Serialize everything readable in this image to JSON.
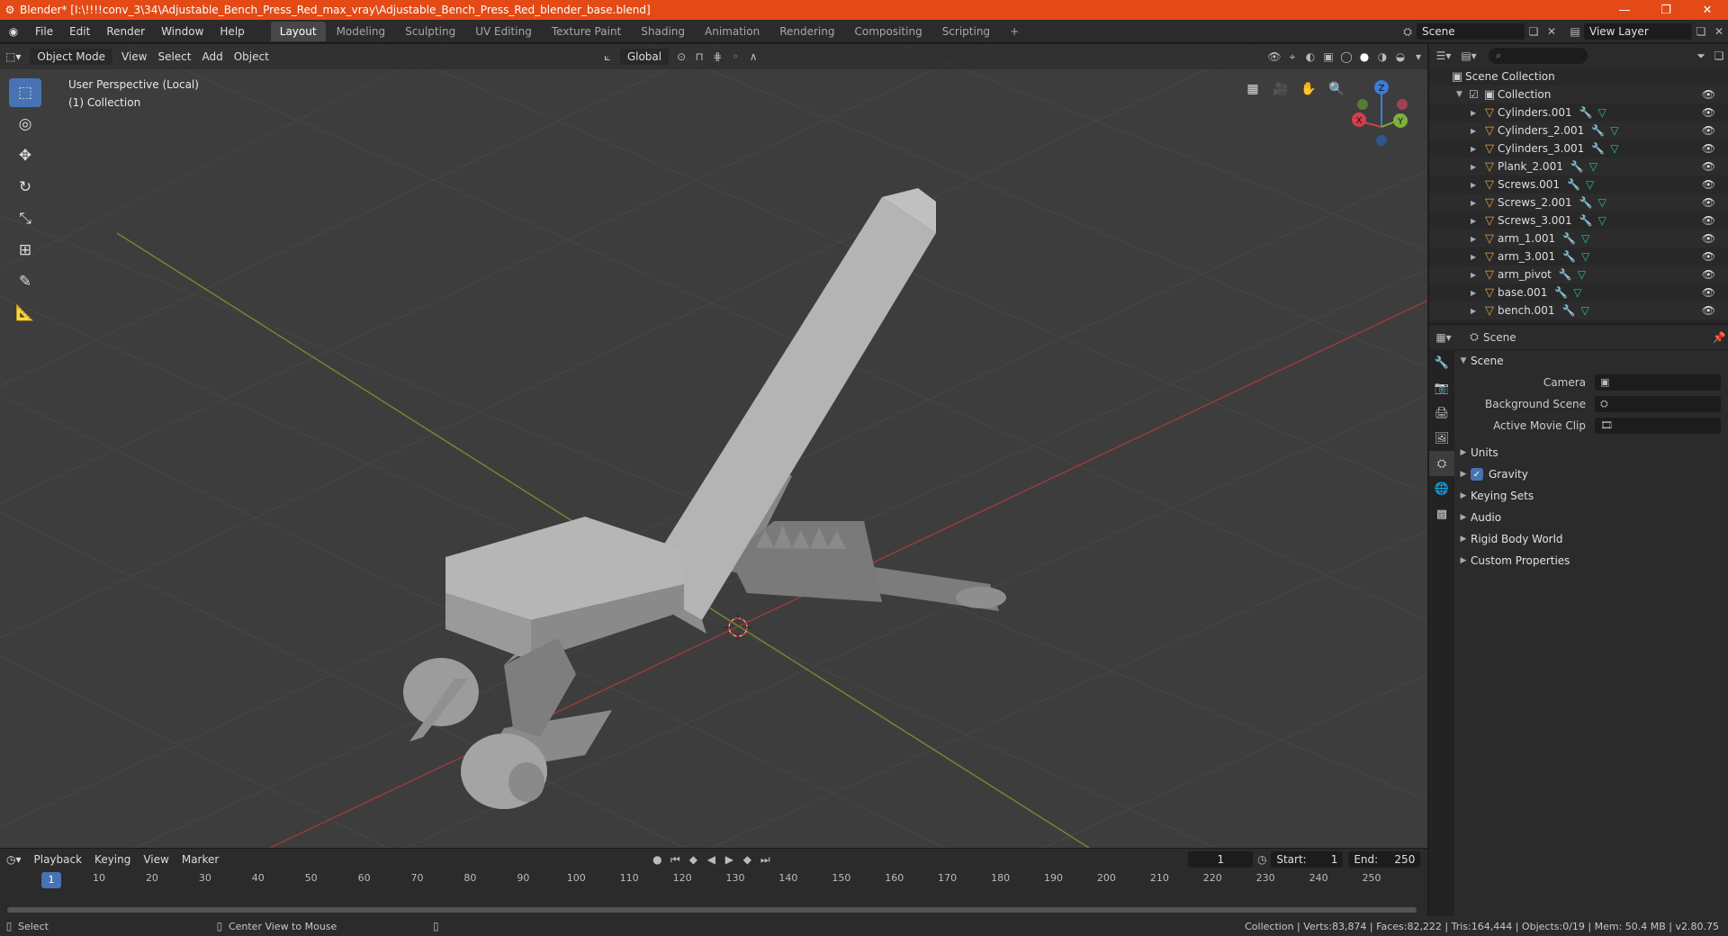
{
  "window": {
    "title": "Blender* [I:\\!!!!conv_3\\34\\Adjustable_Bench_Press_Red_max_vray\\Adjustable_Bench_Press_Red_blender_base.blend]",
    "minimize": "—",
    "maximize": "❐",
    "close": "✕"
  },
  "menu": [
    "File",
    "Edit",
    "Render",
    "Window",
    "Help"
  ],
  "workspaces": [
    "Layout",
    "Modeling",
    "Sculpting",
    "UV Editing",
    "Texture Paint",
    "Shading",
    "Animation",
    "Rendering",
    "Compositing",
    "Scripting"
  ],
  "active_workspace": "Layout",
  "scene_field": "Scene",
  "view_layer_field": "View Layer",
  "viewport": {
    "mode": "Object Mode",
    "menus": [
      "View",
      "Select",
      "Add",
      "Object"
    ],
    "transform_orientation": "Global",
    "info_line1": "User Perspective (Local)",
    "info_line2": "(1) Collection",
    "gizmo": {
      "x": "X",
      "y": "Y",
      "z": "Z"
    }
  },
  "timeline": {
    "menus": [
      "Playback",
      "Keying",
      "View",
      "Marker"
    ],
    "current_frame": "1",
    "start_label": "Start:",
    "start": "1",
    "end_label": "End:",
    "end": "250",
    "ticks": [
      "1",
      "10",
      "20",
      "30",
      "40",
      "50",
      "60",
      "70",
      "80",
      "90",
      "100",
      "110",
      "120",
      "130",
      "140",
      "150",
      "160",
      "170",
      "180",
      "190",
      "200",
      "210",
      "220",
      "230",
      "240",
      "250"
    ]
  },
  "statusbar": {
    "select": "Select",
    "center_view": "Center View to Mouse",
    "stats": "Collection | Verts:83,874 | Faces:82,222 | Tris:164,444 | Objects:0/19 | Mem: 50.4 MB | v2.80.75"
  },
  "outliner": {
    "root": "Scene Collection",
    "collection": "Collection",
    "items": [
      "Cylinders.001",
      "Cylinders_2.001",
      "Cylinders_3.001",
      "Plank_2.001",
      "Screws.001",
      "Screws_2.001",
      "Screws_3.001",
      "arm_1.001",
      "arm_3.001",
      "arm_pivot",
      "base.001",
      "bench.001"
    ]
  },
  "properties": {
    "context": "Scene",
    "panel": "Scene",
    "camera_label": "Camera",
    "background_scene_label": "Background Scene",
    "active_movie_clip_label": "Active Movie Clip",
    "sections": [
      "Units",
      "Gravity",
      "Keying Sets",
      "Audio",
      "Rigid Body World",
      "Custom Properties"
    ]
  }
}
